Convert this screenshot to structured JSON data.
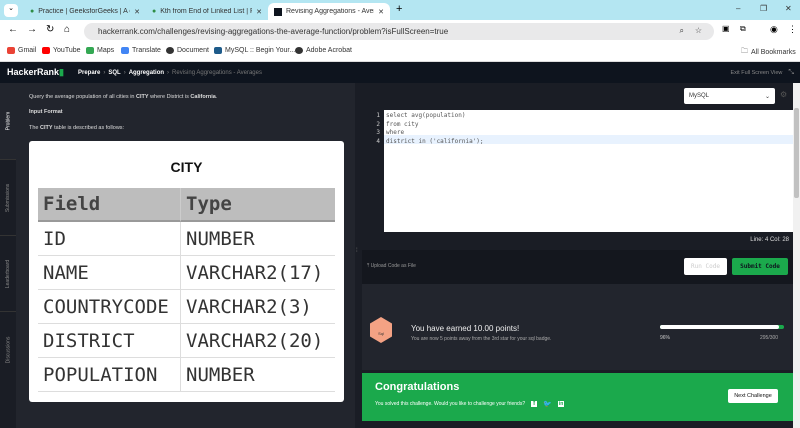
{
  "browser": {
    "tabs": [
      {
        "label": "Practice | GeeksforGeeks | A co"
      },
      {
        "label": "Kth from End of Linked List | Pr"
      },
      {
        "label": "Revising Aggregations - Averag"
      }
    ],
    "url": "hackerrank.com/challenges/revising-aggregations-the-average-function/problem?isFullScreen=true",
    "bookmarks": [
      {
        "label": "Gmail",
        "color": "#ea4335"
      },
      {
        "label": "YouTube",
        "color": "#ff0000"
      },
      {
        "label": "Maps",
        "color": "#34a853"
      },
      {
        "label": "Translate",
        "color": "#4285f4"
      },
      {
        "label": "Document",
        "color": "#333333"
      },
      {
        "label": "MySQL :: Begin Your...",
        "color": "#1e5b8a"
      },
      {
        "label": "Adobe Acrobat",
        "color": "#333333"
      }
    ],
    "all_bookmarks": "All Bookmarks"
  },
  "header": {
    "logo": "HackerRank",
    "breadcrumb": [
      "Prepare",
      "SQL",
      "Aggregation",
      "Revising Aggregations - Averages"
    ],
    "exit": "Exit Full Screen View"
  },
  "side_tabs": [
    "Problem",
    "Submissions",
    "Leaderboard",
    "Discussions"
  ],
  "problem": {
    "q_pre": "Query the average population of all cities in ",
    "q_city": "CITY",
    "q_mid": " where District is ",
    "q_cal": "California",
    "q_end": ".",
    "input_format": "Input Format",
    "desc_pre": "The ",
    "desc_city": "CITY",
    "desc_post": " table is described as follows:",
    "table": {
      "title": "CITY",
      "headers": [
        "Field",
        "Type"
      ],
      "rows": [
        [
          "ID",
          "NUMBER"
        ],
        [
          "NAME",
          "VARCHAR2(17)"
        ],
        [
          "COUNTRYCODE",
          "VARCHAR2(3)"
        ],
        [
          "DISTRICT",
          "VARCHAR2(20)"
        ],
        [
          "POPULATION",
          "NUMBER"
        ]
      ]
    }
  },
  "editor": {
    "language": "MySQL",
    "lines": [
      "select avg(population)",
      "from city",
      "where",
      "district in ('california');"
    ],
    "line_numbers": [
      "1",
      "2",
      "3",
      "4"
    ],
    "status": "Line: 4 Col: 28"
  },
  "actions": {
    "upload": "Upload Code as File",
    "run": "Run Code",
    "submit": "Submit Code"
  },
  "result": {
    "badge_text": "Sql",
    "points": "You have earned 10.00 points!",
    "sub": "You are now 5 points away from the 3rd star for your sql badge.",
    "progress": 96,
    "progress_label": "96%",
    "score": "295/300"
  },
  "congrats": {
    "title": "Congratulations",
    "sub": "You solved this challenge. Would you like to challenge your friends?",
    "next": "Next Challenge",
    "colors": {
      "green": "#1ba94c"
    }
  }
}
